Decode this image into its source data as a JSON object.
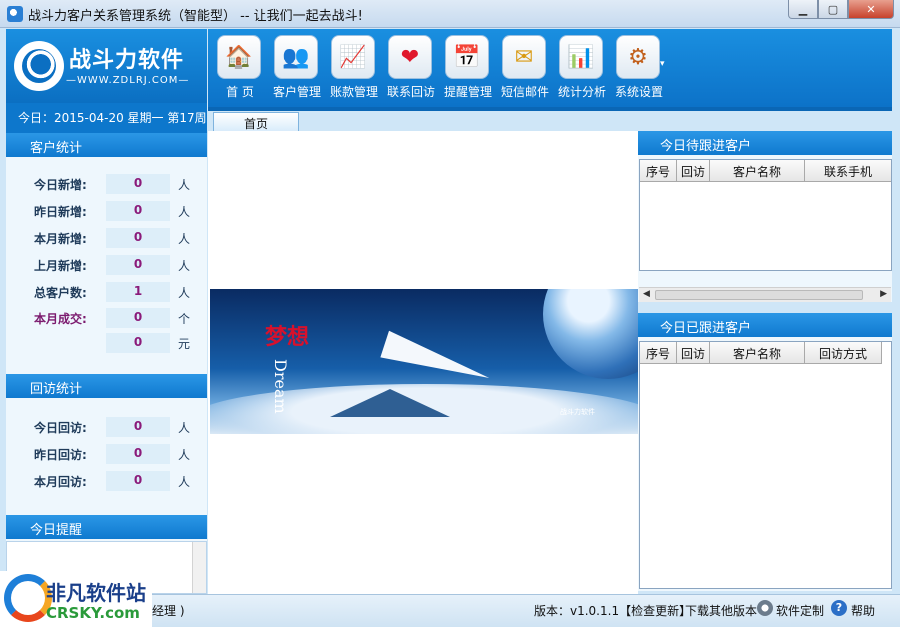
{
  "window": {
    "title": "战斗力客户关系管理系统（智能型） -- 让我们一起去战斗!",
    "buttons": {
      "minimize": "▁",
      "maximize": "▢",
      "close": "✕"
    }
  },
  "brand": {
    "name": "战斗力软件",
    "url": "—WWW.ZDLRJ.COM—"
  },
  "date_line": "今日：2015-04-20 星期一 第17周",
  "toolbar": {
    "items": [
      {
        "label": "首 页",
        "icon": "home-icon",
        "glyph": "🏠"
      },
      {
        "label": "客户管理",
        "icon": "customer-icon",
        "glyph": "👥"
      },
      {
        "label": "账款管理",
        "icon": "chart-icon",
        "glyph": "📈"
      },
      {
        "label": "联系回访",
        "icon": "heart-icon",
        "glyph": "❤"
      },
      {
        "label": "提醒管理",
        "icon": "calendar-icon",
        "glyph": "📅"
      },
      {
        "label": "短信邮件",
        "icon": "mail-icon",
        "glyph": "✉"
      },
      {
        "label": "统计分析",
        "icon": "analysis-icon",
        "glyph": "📊"
      },
      {
        "label": "系统设置",
        "icon": "settings-icon",
        "glyph": "⚙"
      }
    ],
    "more": "▾"
  },
  "tabs": {
    "home": "首页"
  },
  "customer_stats": {
    "title": "客户统计",
    "rows": [
      {
        "label": "今日新增:",
        "value": "0",
        "unit": "人"
      },
      {
        "label": "昨日新增:",
        "value": "0",
        "unit": "人"
      },
      {
        "label": "本月新增:",
        "value": "0",
        "unit": "人"
      },
      {
        "label": "上月新增:",
        "value": "0",
        "unit": "人"
      },
      {
        "label": "总客户数:",
        "value": "1",
        "unit": "人"
      },
      {
        "label": "本月成交:",
        "value": "0",
        "unit": "个"
      },
      {
        "label": "",
        "value": "0",
        "unit": "元"
      }
    ]
  },
  "visit_stats": {
    "title": "回访统计",
    "rows": [
      {
        "label": "今日回访:",
        "value": "0",
        "unit": "人"
      },
      {
        "label": "昨日回访:",
        "value": "0",
        "unit": "人"
      },
      {
        "label": "本月回访:",
        "value": "0",
        "unit": "人"
      }
    ]
  },
  "reminder": {
    "title": "今日提醒"
  },
  "banner": {
    "cn": "梦想",
    "en": "Dream",
    "logo": "战斗力软件"
  },
  "pending_panel": {
    "title": "今日待跟进客户",
    "columns": [
      "序号",
      "回访",
      "客户名称",
      "联系手机"
    ]
  },
  "done_panel": {
    "title": "今日已跟进客户",
    "columns": [
      "序号",
      "回访",
      "客户名称",
      "回访方式"
    ]
  },
  "status": {
    "user": "总经理 )",
    "version": "版本：v1.0.1.1【检查更新】",
    "download": "下载其他版本",
    "custom": "软件定制",
    "help": "帮助",
    "help_glyph": "?"
  },
  "watermark": {
    "name": "非凡软件站",
    "url": "CRSKY.com"
  },
  "colors": {
    "accent": "#0f79cf",
    "value": "#8a1a7a"
  }
}
